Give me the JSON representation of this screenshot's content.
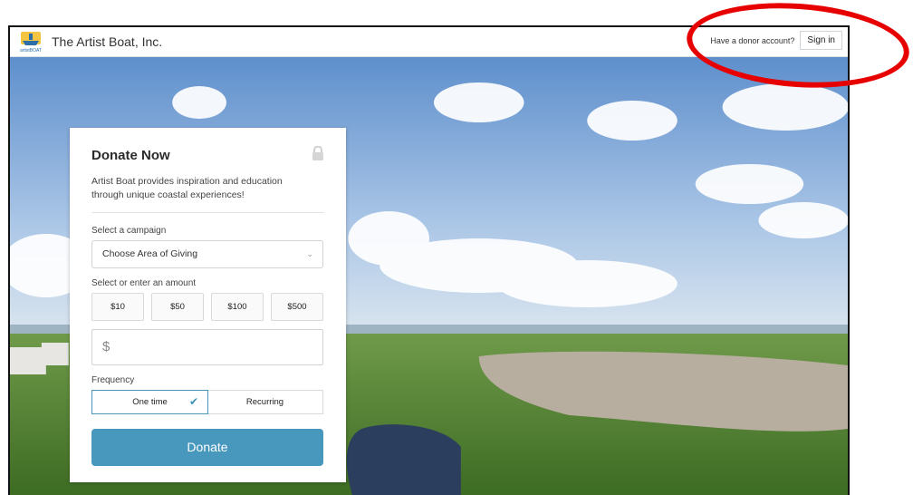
{
  "header": {
    "org_name": "The Artist Boat, Inc.",
    "donor_question": "Have a donor account?",
    "sign_in_label": "Sign in"
  },
  "form": {
    "title": "Donate Now",
    "description": "Artist Boat provides inspiration and education through unique coastal experiences!",
    "campaign_label": "Select a campaign",
    "campaign_value": "Choose Area of Giving",
    "amount_label": "Select or enter an amount",
    "amounts": [
      "$10",
      "$50",
      "$100",
      "$500"
    ],
    "custom_amount_placeholder": "$",
    "frequency_label": "Frequency",
    "frequency_options": [
      "One time",
      "Recurring"
    ],
    "frequency_selected": "One time",
    "donate_label": "Donate"
  },
  "colors": {
    "accent": "#4897bd",
    "annotation": "#e60000"
  }
}
